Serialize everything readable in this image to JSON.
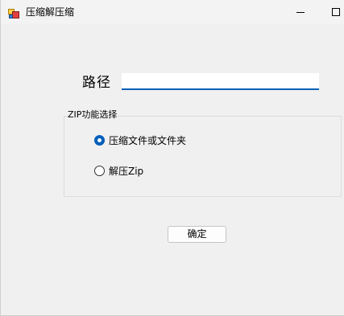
{
  "window": {
    "title": "压缩解压缩",
    "icon": "app-icon"
  },
  "form": {
    "path_label": "路径",
    "path_value": "",
    "path_placeholder": ""
  },
  "zip_group": {
    "legend": "ZIP功能选择",
    "options": [
      {
        "label": "压缩文件或文件夹",
        "checked": true
      },
      {
        "label": "解压Zip",
        "checked": false
      }
    ]
  },
  "confirm_label": "确定",
  "colors": {
    "accent": "#005fb8",
    "background": "#f0f0f0"
  }
}
